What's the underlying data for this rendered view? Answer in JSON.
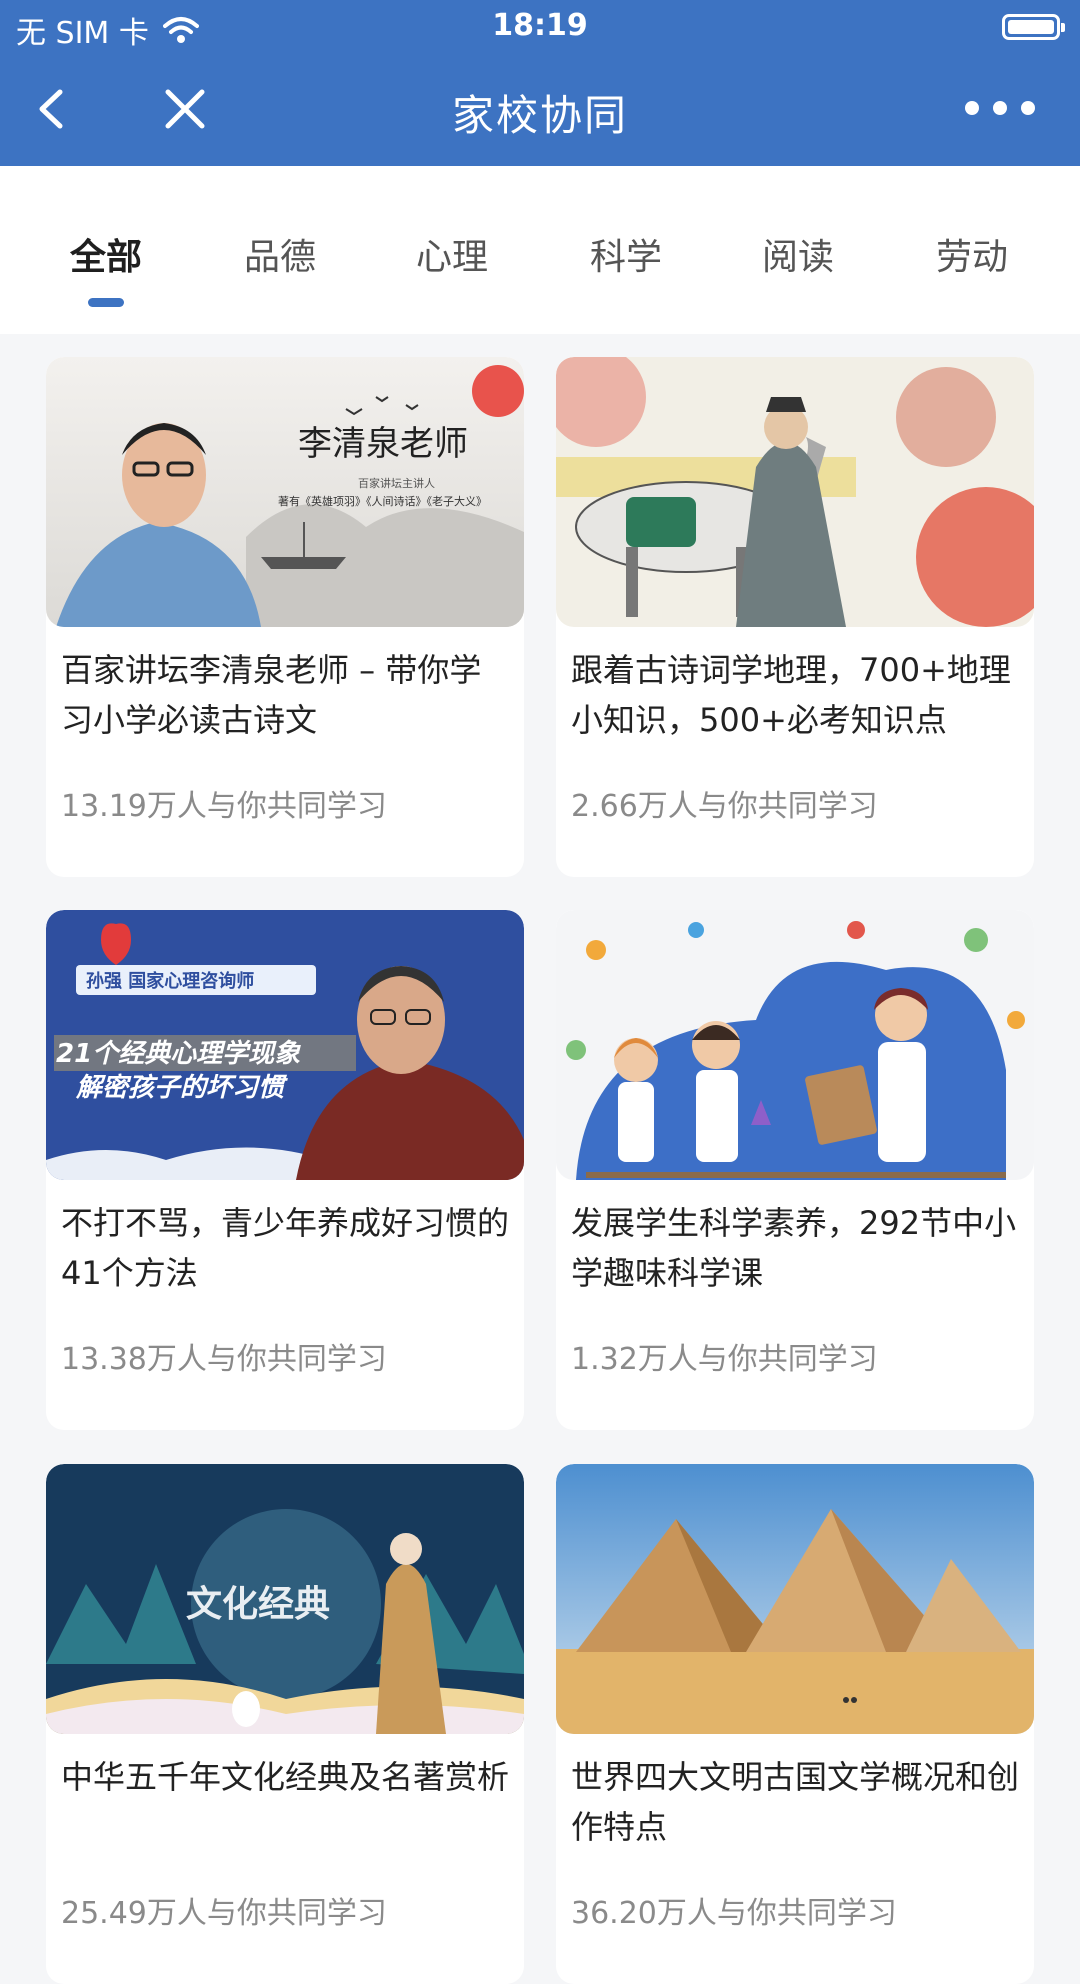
{
  "status_bar": {
    "carrier": "无 SIM 卡",
    "time": "18:19"
  },
  "nav": {
    "title": "家校协同"
  },
  "tabs": [
    "全部",
    "品德",
    "心理",
    "科学",
    "阅读",
    "劳动"
  ],
  "active_tab": "全部",
  "courses": [
    {
      "title": "百家讲坛李清泉老师 – 带你学习小学必读古诗文",
      "learners": "13.19万人与你共同学习",
      "thumb_text": {
        "name": "李清泉老师",
        "sub1": "百家讲坛主讲人",
        "sub2": "著有《英雄项羽》《人间诗话》《老子大义》"
      }
    },
    {
      "title": "跟着古诗词学地理，700+地理小知识，500+必考知识点",
      "learners": "2.66万人与你共同学习"
    },
    {
      "title": "不打不骂，青少年养成好习惯的41个方法",
      "learners": "13.38万人与你共同学习",
      "thumb_text": {
        "tag": "孙强  国家心理咨询师",
        "line1": "21个经典心理学现象",
        "line2": "解密孩子的坏习惯"
      }
    },
    {
      "title": "发展学生科学素养，292节中小学趣味科学课",
      "learners": "1.32万人与你共同学习"
    },
    {
      "title": "中华五千年文化经典及名著赏析",
      "learners": "25.49万人与你共同学习",
      "thumb_text": {
        "name": "文化经典"
      }
    },
    {
      "title": "世界四大文明古国文学概况和创作特点",
      "learners": "36.20万人与你共同学习"
    }
  ]
}
